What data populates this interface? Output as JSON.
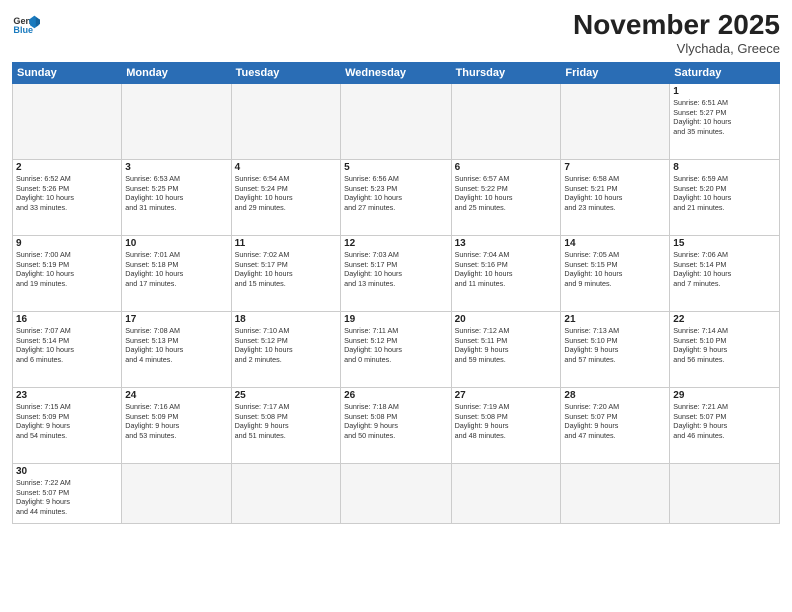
{
  "header": {
    "logo_general": "General",
    "logo_blue": "Blue",
    "month": "November 2025",
    "location": "Vlychada, Greece"
  },
  "days_of_week": [
    "Sunday",
    "Monday",
    "Tuesday",
    "Wednesday",
    "Thursday",
    "Friday",
    "Saturday"
  ],
  "weeks": [
    [
      {
        "day": "",
        "info": ""
      },
      {
        "day": "",
        "info": ""
      },
      {
        "day": "",
        "info": ""
      },
      {
        "day": "",
        "info": ""
      },
      {
        "day": "",
        "info": ""
      },
      {
        "day": "",
        "info": ""
      },
      {
        "day": "1",
        "info": "Sunrise: 6:51 AM\nSunset: 5:27 PM\nDaylight: 10 hours\nand 35 minutes."
      }
    ],
    [
      {
        "day": "2",
        "info": "Sunrise: 6:52 AM\nSunset: 5:26 PM\nDaylight: 10 hours\nand 33 minutes."
      },
      {
        "day": "3",
        "info": "Sunrise: 6:53 AM\nSunset: 5:25 PM\nDaylight: 10 hours\nand 31 minutes."
      },
      {
        "day": "4",
        "info": "Sunrise: 6:54 AM\nSunset: 5:24 PM\nDaylight: 10 hours\nand 29 minutes."
      },
      {
        "day": "5",
        "info": "Sunrise: 6:56 AM\nSunset: 5:23 PM\nDaylight: 10 hours\nand 27 minutes."
      },
      {
        "day": "6",
        "info": "Sunrise: 6:57 AM\nSunset: 5:22 PM\nDaylight: 10 hours\nand 25 minutes."
      },
      {
        "day": "7",
        "info": "Sunrise: 6:58 AM\nSunset: 5:21 PM\nDaylight: 10 hours\nand 23 minutes."
      },
      {
        "day": "8",
        "info": "Sunrise: 6:59 AM\nSunset: 5:20 PM\nDaylight: 10 hours\nand 21 minutes."
      }
    ],
    [
      {
        "day": "9",
        "info": "Sunrise: 7:00 AM\nSunset: 5:19 PM\nDaylight: 10 hours\nand 19 minutes."
      },
      {
        "day": "10",
        "info": "Sunrise: 7:01 AM\nSunset: 5:18 PM\nDaylight: 10 hours\nand 17 minutes."
      },
      {
        "day": "11",
        "info": "Sunrise: 7:02 AM\nSunset: 5:17 PM\nDaylight: 10 hours\nand 15 minutes."
      },
      {
        "day": "12",
        "info": "Sunrise: 7:03 AM\nSunset: 5:17 PM\nDaylight: 10 hours\nand 13 minutes."
      },
      {
        "day": "13",
        "info": "Sunrise: 7:04 AM\nSunset: 5:16 PM\nDaylight: 10 hours\nand 11 minutes."
      },
      {
        "day": "14",
        "info": "Sunrise: 7:05 AM\nSunset: 5:15 PM\nDaylight: 10 hours\nand 9 minutes."
      },
      {
        "day": "15",
        "info": "Sunrise: 7:06 AM\nSunset: 5:14 PM\nDaylight: 10 hours\nand 7 minutes."
      }
    ],
    [
      {
        "day": "16",
        "info": "Sunrise: 7:07 AM\nSunset: 5:14 PM\nDaylight: 10 hours\nand 6 minutes."
      },
      {
        "day": "17",
        "info": "Sunrise: 7:08 AM\nSunset: 5:13 PM\nDaylight: 10 hours\nand 4 minutes."
      },
      {
        "day": "18",
        "info": "Sunrise: 7:10 AM\nSunset: 5:12 PM\nDaylight: 10 hours\nand 2 minutes."
      },
      {
        "day": "19",
        "info": "Sunrise: 7:11 AM\nSunset: 5:12 PM\nDaylight: 10 hours\nand 0 minutes."
      },
      {
        "day": "20",
        "info": "Sunrise: 7:12 AM\nSunset: 5:11 PM\nDaylight: 9 hours\nand 59 minutes."
      },
      {
        "day": "21",
        "info": "Sunrise: 7:13 AM\nSunset: 5:10 PM\nDaylight: 9 hours\nand 57 minutes."
      },
      {
        "day": "22",
        "info": "Sunrise: 7:14 AM\nSunset: 5:10 PM\nDaylight: 9 hours\nand 56 minutes."
      }
    ],
    [
      {
        "day": "23",
        "info": "Sunrise: 7:15 AM\nSunset: 5:09 PM\nDaylight: 9 hours\nand 54 minutes."
      },
      {
        "day": "24",
        "info": "Sunrise: 7:16 AM\nSunset: 5:09 PM\nDaylight: 9 hours\nand 53 minutes."
      },
      {
        "day": "25",
        "info": "Sunrise: 7:17 AM\nSunset: 5:08 PM\nDaylight: 9 hours\nand 51 minutes."
      },
      {
        "day": "26",
        "info": "Sunrise: 7:18 AM\nSunset: 5:08 PM\nDaylight: 9 hours\nand 50 minutes."
      },
      {
        "day": "27",
        "info": "Sunrise: 7:19 AM\nSunset: 5:08 PM\nDaylight: 9 hours\nand 48 minutes."
      },
      {
        "day": "28",
        "info": "Sunrise: 7:20 AM\nSunset: 5:07 PM\nDaylight: 9 hours\nand 47 minutes."
      },
      {
        "day": "29",
        "info": "Sunrise: 7:21 AM\nSunset: 5:07 PM\nDaylight: 9 hours\nand 46 minutes."
      }
    ],
    [
      {
        "day": "30",
        "info": "Sunrise: 7:22 AM\nSunset: 5:07 PM\nDaylight: 9 hours\nand 44 minutes."
      },
      {
        "day": "",
        "info": ""
      },
      {
        "day": "",
        "info": ""
      },
      {
        "day": "",
        "info": ""
      },
      {
        "day": "",
        "info": ""
      },
      {
        "day": "",
        "info": ""
      },
      {
        "day": "",
        "info": ""
      }
    ]
  ]
}
